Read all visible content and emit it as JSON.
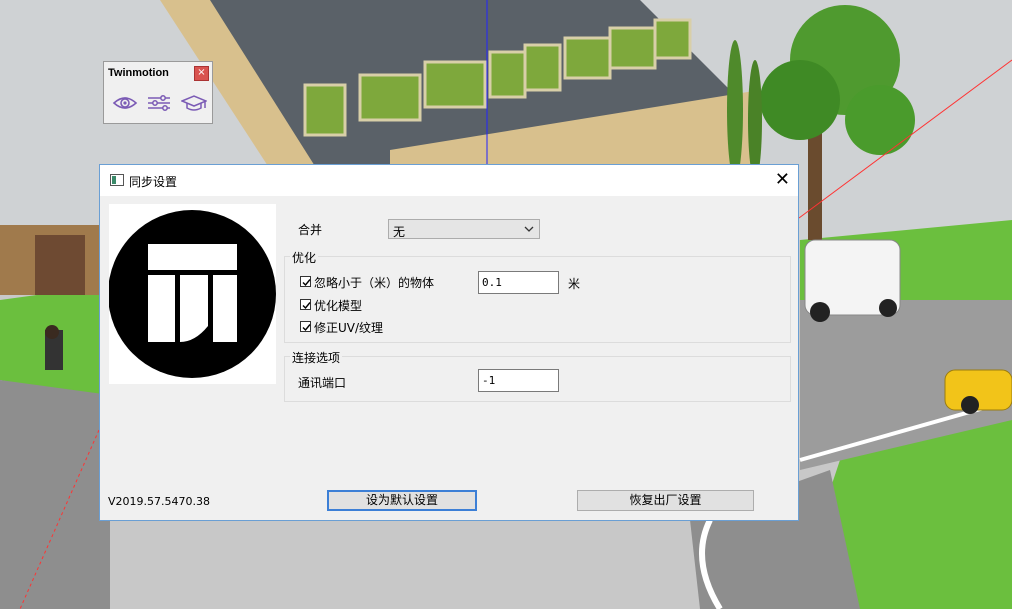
{
  "toolbar": {
    "title": "Twinmotion",
    "close_glyph": "×",
    "icons": [
      "eye-icon",
      "sliders-icon",
      "graduation-cap-icon"
    ],
    "accent_color": "#7b5bb5"
  },
  "dialog": {
    "title": "同步设置",
    "close_glyph": "✕",
    "merge_label": "合并",
    "merge_value": "无",
    "optimize_group": "优化",
    "ignore_label": "忽略小于（米）的物体",
    "ignore_value": "0.1",
    "ignore_unit": "米",
    "optimize_model_label": "优化模型",
    "fix_uv_label": "修正UV/纹理",
    "connection_group": "连接选项",
    "port_label": "通讯端口",
    "port_value": "-1",
    "version": "V2019.57.5470.38",
    "set_default_label": "设为默认设置",
    "restore_label": "恢复出厂设置",
    "checkboxes": {
      "ignore": true,
      "optimize_model": true,
      "fix_uv": true
    }
  }
}
